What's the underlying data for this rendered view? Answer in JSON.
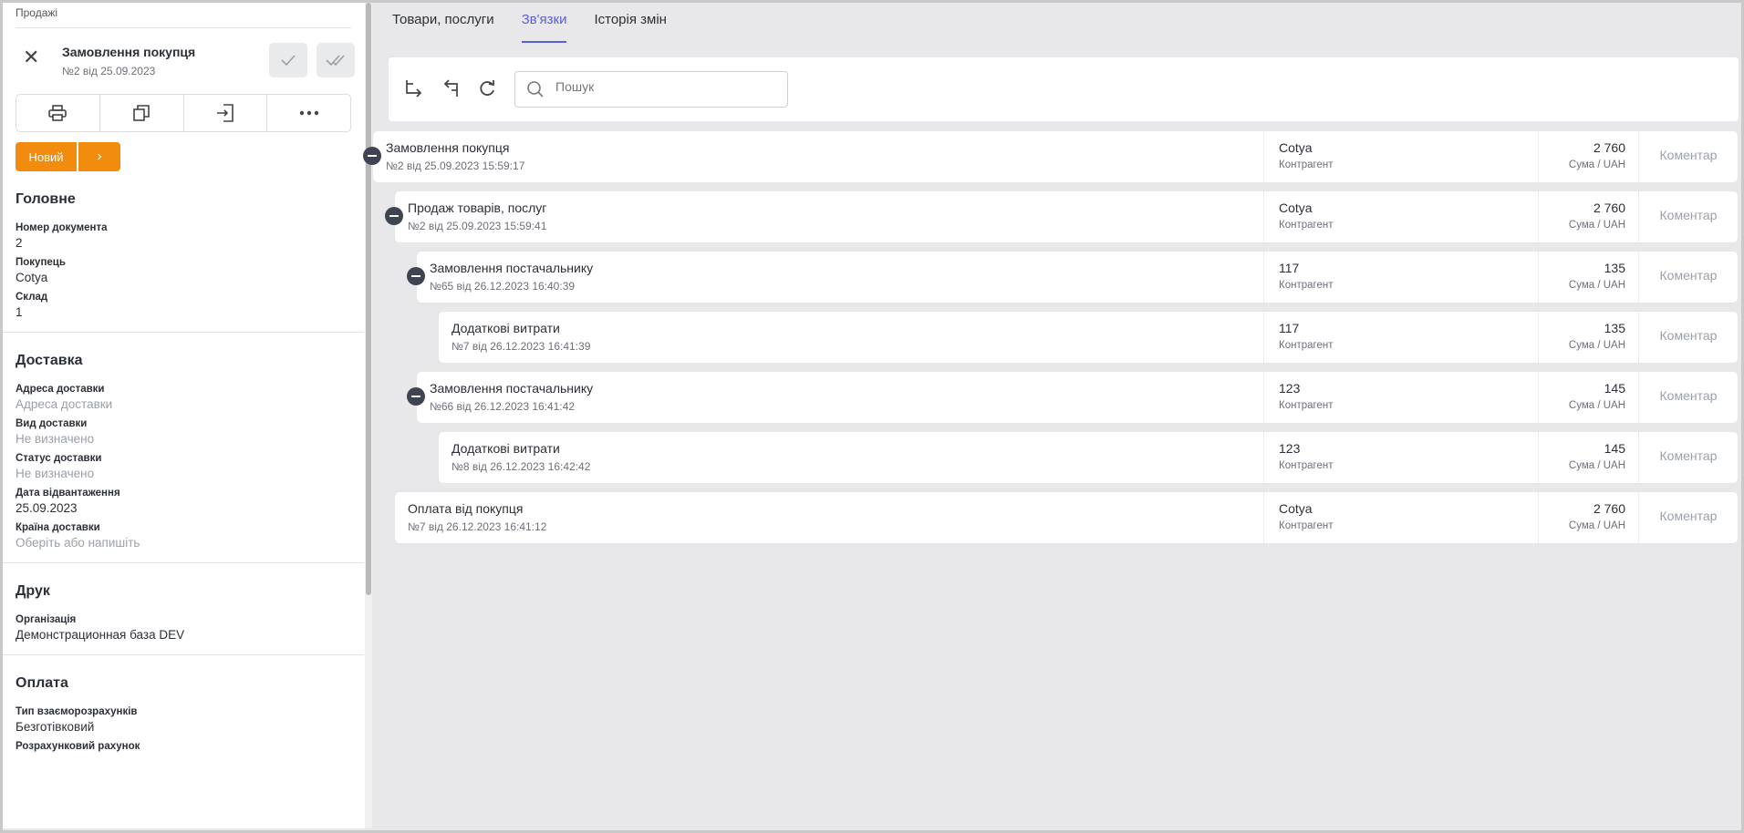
{
  "breadcrumb": "Продажі",
  "document": {
    "title": "Замовлення покупця",
    "subtitle": "№2 від 25.09.2023",
    "status": "Новий"
  },
  "toolbar_icons": [
    "print-icon",
    "copy-icon",
    "import-icon",
    "more-icon"
  ],
  "sections": {
    "main": {
      "title": "Головне",
      "doc_number_label": "Номер документа",
      "doc_number": "2",
      "buyer_label": "Покупець",
      "buyer": "Cotya",
      "warehouse_label": "Склад",
      "warehouse": "1"
    },
    "delivery": {
      "title": "Доставка",
      "address_label": "Адреса доставки",
      "address_placeholder": "Адреса доставки",
      "type_label": "Вид доставки",
      "type_value": "Не визначено",
      "status_label": "Статус доставки",
      "status_value": "Не визначено",
      "ship_date_label": "Дата відвантаження",
      "ship_date": "25.09.2023",
      "country_label": "Країна доставки",
      "country_placeholder": "Оберіть або напишіть"
    },
    "print": {
      "title": "Друк",
      "org_label": "Організація",
      "org_value": "Демонстрационная база DEV"
    },
    "payment": {
      "title": "Оплата",
      "settlement_label": "Тип взаєморозрахунків",
      "settlement_value": "Безготівковий",
      "account_label": "Розрахунковий рахунок"
    }
  },
  "tabs": [
    {
      "label": "Товари, послуги"
    },
    {
      "label": "Зв'язки"
    },
    {
      "label": "Історія змін"
    }
  ],
  "search": {
    "placeholder": "Пошук"
  },
  "relations": [
    {
      "title": "Замовлення покупця",
      "sub": "№2 від 25.09.2023 15:59:17",
      "contractor": "Cotya",
      "contractor_label": "Контрагент",
      "amount": "2 760",
      "amount_label": "Сума / UAH",
      "comment": "Коментар"
    },
    {
      "title": "Продаж товарів, послуг",
      "sub": "№2 від 25.09.2023 15:59:41",
      "contractor": "Cotya",
      "contractor_label": "Контрагент",
      "amount": "2 760",
      "amount_label": "Сума / UAH",
      "comment": "Коментар"
    },
    {
      "title": "Замовлення постачальнику",
      "sub": "№65 від 26.12.2023 16:40:39",
      "contractor": "117",
      "contractor_label": "Контрагент",
      "amount": "135",
      "amount_label": "Сума / UAH",
      "comment": "Коментар"
    },
    {
      "title": "Додаткові витрати",
      "sub": "№7 від 26.12.2023 16:41:39",
      "contractor": "117",
      "contractor_label": "Контрагент",
      "amount": "135",
      "amount_label": "Сума / UAH",
      "comment": "Коментар"
    },
    {
      "title": "Замовлення постачальнику",
      "sub": "№66 від 26.12.2023 16:41:42",
      "contractor": "123",
      "contractor_label": "Контрагент",
      "amount": "145",
      "amount_label": "Сума / UAH",
      "comment": "Коментар"
    },
    {
      "title": "Додаткові витрати",
      "sub": "№8 від 26.12.2023 16:42:42",
      "contractor": "123",
      "contractor_label": "Контрагент",
      "amount": "145",
      "amount_label": "Сума / UAH",
      "comment": "Коментар"
    },
    {
      "title": "Оплата від покупця",
      "sub": "№7 від 26.12.2023 16:41:12",
      "contractor": "Cotya",
      "contractor_label": "Контрагент",
      "amount": "2 760",
      "amount_label": "Сума / UAH",
      "comment": "Коментар"
    }
  ],
  "colors": {
    "accent": "#5b5fd6",
    "status": "#f28c0f"
  }
}
